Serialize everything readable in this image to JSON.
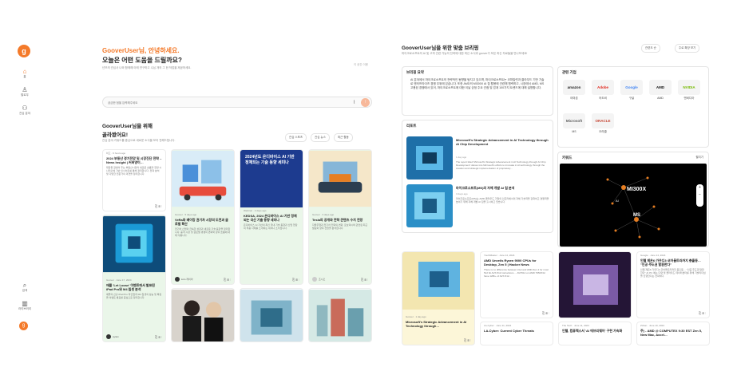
{
  "rail": {
    "logo": "g",
    "items": [
      {
        "icon": "home-icon",
        "label": "홈"
      },
      {
        "icon": "user-icon",
        "label": "팔로우"
      },
      {
        "icon": "group-icon",
        "label": "관심 분야"
      },
      {
        "icon": "search-icon",
        "label": "검색"
      },
      {
        "icon": "library-icon",
        "label": "라이브러리"
      }
    ],
    "avatar": "g"
  },
  "left": {
    "greet_name": "GooverUser님, 안녕하세요.",
    "greet_question": "오늘은 어떤 도움을 드릴까요?",
    "greet_sub": "넌뜨의 관심사 나와 함께해 아래 연구하고 수십 개의 그 한 작업을 제공하세요.",
    "ghost_link": "이 공간 이용",
    "search_placeholder": "궁금한 점을 입력해주세요",
    "section_title_1": "GooverUser님을 위해",
    "section_title_2": "골라봤어요!",
    "section_sub": "관심 분야 키워드를 중심으로 새로운 소식을 모아 전해드립니다.",
    "filters": [
      "관심 스포츠",
      "관심 뉴스",
      "최근 활동"
    ],
    "cards": [
      {
        "meta": "하고 · 9 hours ago",
        "title": "2024 부동산 경기전망 및 시장진단 전략 – News Insight | 커버영이…",
        "snippet": "대장들 갈생이 주는 부동산시장의 새로운 흐름과 전망 시나리오에 기반 인사이트를 통해 정리합니다. 전략 분석 및 다양한 전문가의 의견을 정리합니다.",
        "variant": "white"
      },
      {
        "meta": "Goover · 5 days ago",
        "title": "VeRa와 베이징 권기차 시장의 도전과 글로벌 확산",
        "snippet": "전기차 산업의 급속한 성장과 새로운 기술 동향을 정리합니다. 중국 시장 및 글로벌 경쟁의 변화와 향후 흐름에 대해 다룹니다.",
        "variant": "green",
        "author": "kolo 레이아"
      },
      {
        "meta": "Webinar · 2 days ago",
        "title": "KEDSA, 2024 온디바이스 AI 기반 정체되는 국산 기술 동향 세미나",
        "snippet": "온디바이스 AI 기반의 최신 국내 기술 동향과 산업 현장의 적용 사례를 소개하는 세미나 소식입니다.",
        "variant": "green",
        "banner": "2024년도 온디바이스 AI 기반 정체되는 기술 동향 세미나"
      },
      {
        "meta": "Goover · 3 days ago",
        "title": "Tesla의 공개와 전략 콘텐츠 수치 전망",
        "snippet": "자율주행과 전기차 전략의 변화, 로보택시와 관련된 최근 발표와 향후 전망을 분석합니다.",
        "variant": "green",
        "author": "조시오"
      },
      {
        "meta": "Goover · June 17, 2024",
        "title": "애플 'Let Loose' 이벤트에서 발표된 iPad Pro와 M4 칩셋 분석",
        "snippet": "애플의 신규 iPad Pro 라인업과 M4 칩셋의 성능 및 특징을 이벤트 발표를 중심으로 정리합니다.",
        "variant": "green",
        "author": "aylain"
      },
      {
        "meta": "",
        "title": "",
        "snippet": "",
        "variant": "white"
      },
      {
        "meta": "",
        "title": "",
        "snippet": "",
        "variant": "white"
      },
      {
        "meta": "",
        "title": "",
        "snippet": "",
        "variant": "white"
      }
    ]
  },
  "right": {
    "title": "GooverUser님을 위한 맞춤 브리핑",
    "subtitle": "마이크로소프트의 AI 및 고객 관련 가능의 전략에 대한 최신 소식과 goover가 모은 최신 자료들을 만나보세요!",
    "sort_label": "관련도 순",
    "weekly_label": "주로 확장 보기",
    "summary_header": "브리핑 요약",
    "summary_text": "AI 분야에서 마이크로소프트의 전략적인 동향을 탐지고 있으며, 마이크로소프트는 코파일럿과 클라우드 기반 기술로 엔터프라이즈 경쟁 우위에 있습니다. 또한 AMD의 MI300X AI 칩 활용에 관련해 협력하고, 시장에서 AMD, MS 고용된 경쟁에서 있어, 마이크로소프트에 대한 이날 긍정 주요 관점 및 업계 100가지 트렌드에 대해 설명합니다.",
    "report_header": "리포트",
    "reports": [
      {
        "title": "Microsoft's Strategic Advancement in AI Technology through AI Chip Development",
        "meta": "1 day ago",
        "snippet": "The report titled 'Microsoft's Strategic Advancement in AI Technology through AI Chip Development' delves into Microsoft's efforts to innovate in AI technology through the creation and strategic implementation of proprietary..."
      },
      {
        "title": "마이크로소프트(MS)의 자체 개발 AI 칩 분석",
        "meta": "3 days ago",
        "snippet": "마이크로소프트(MS)는 AMD 클라우드 기업의 인프라에서의 자체 기술력을 강화하고 경쟁력을 높이기 위해 자체 개발 AI 칩을 출시하고 있습니다."
      }
    ],
    "companies_header": "관련 기업",
    "companies": [
      {
        "logo": "amazon",
        "name": "아마존",
        "color": "#222222"
      },
      {
        "logo": "Adobe",
        "name": "어도비",
        "color": "#e1251b"
      },
      {
        "logo": "Google",
        "name": "구글",
        "color": "#4285f4"
      },
      {
        "logo": "AMD",
        "name": "AMD",
        "color": "#111111"
      },
      {
        "logo": "NVIDIA",
        "name": "엔비디아",
        "color": "#76b900"
      },
      {
        "logo": "Microsoft",
        "name": "MS",
        "color": "#5e5e5e"
      },
      {
        "logo": "ORACLE",
        "name": "오라클",
        "color": "#c74634"
      }
    ],
    "keyword_header": "키워드",
    "keyword_btn": "펼치기",
    "keywords": {
      "main": "MI300X",
      "second": "MS",
      "third": "AI"
    },
    "bottom_cards": [
      {
        "meta": "Goover · 1 day ago",
        "title": "Microsoft's Strategic Advancement in AI Technology through…",
        "snippet": ""
      },
      {
        "meta": "YouthMaster · June 14, 2024",
        "title": "AMD Unveils Ryzen 9000 CPUs for Desktop, Zen 5 | Hacker News",
        "snippet": "There is no difference between intel and AMD Zen 4 for most 512 bit AVX-512 instructions ... AVX512 on AMD 7950X3d have 128b+ of AVX-512..."
      },
      {
        "meta": "LA-Cyber · June 11, 2024",
        "title": "LA-Cyber: Current Cyber Threats",
        "snippet": ""
      },
      {
        "meta": "",
        "title": "",
        "snippet": ""
      },
      {
        "meta": "The Tech · June 11, 2024",
        "title": "인텔, 컴퓨텍스서 'AI 에브리웨어' 구현 가속화",
        "snippet": ""
      },
      {
        "meta": "Google · June 14, 2024",
        "title": "인텔 제온6·가우디3·코어울트라까지 총출동… \"인공 주도권 탈환한다\"",
        "snippet": "인텔 제온6·가우디3·코어울트라까지 총출동… \"인공 주도권 탈환한다\" AI PC 에는 다양 및 클라우드 데이터센터를 위해 기술리더십을 진행한다는 전략이다."
      },
      {
        "meta": "Zchan · June 10, 2024",
        "title": "주) - AMD @ COMPUTEX 9:30 EST Zen 5, New Mac, Accel…",
        "snippet": ""
      }
    ]
  }
}
